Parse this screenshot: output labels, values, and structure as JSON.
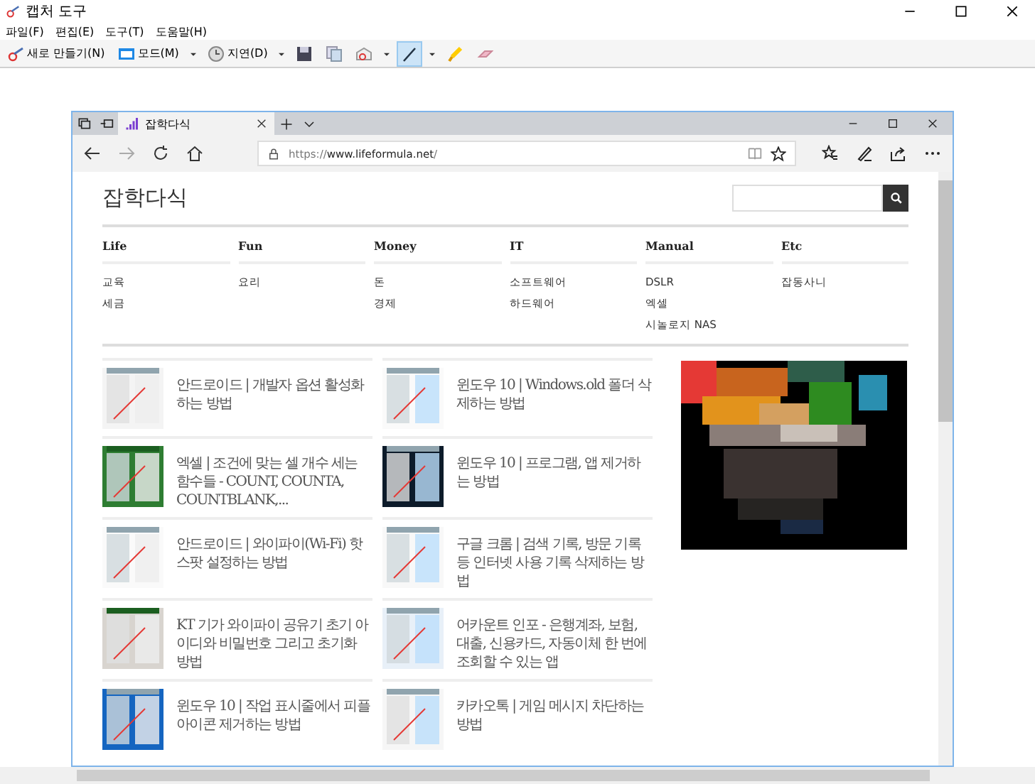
{
  "window": {
    "title": "캡처 도구"
  },
  "menu": [
    "파일(F)",
    "편집(E)",
    "도구(T)",
    "도움말(H)"
  ],
  "toolbar": [
    {
      "kind": "new",
      "label": "새로 만들기(N)",
      "selected": false
    },
    {
      "kind": "mode",
      "label": "모드(M)",
      "selected": false
    },
    {
      "kind": "delay",
      "label": "지연(D)",
      "selected": false
    },
    {
      "kind": "save",
      "selected": false
    },
    {
      "kind": "copy",
      "selected": false
    },
    {
      "kind": "send",
      "selected": false
    },
    {
      "kind": "pen",
      "selected": true
    },
    {
      "kind": "highlighter",
      "selected": false
    },
    {
      "kind": "eraser",
      "selected": false
    }
  ],
  "browser": {
    "tab": {
      "title": "잡학다식"
    },
    "url_prefix": "https://",
    "url_host": "www.lifeformula.net",
    "url_suffix": "/"
  },
  "site": {
    "logo": "잡학다식",
    "nav": [
      {
        "heading": "Life",
        "items": [
          "교육",
          "세금"
        ]
      },
      {
        "heading": "Fun",
        "items": [
          "요리"
        ]
      },
      {
        "heading": "Money",
        "items": [
          "돈",
          "경제"
        ]
      },
      {
        "heading": "IT",
        "items": [
          "소프트웨어",
          "하드웨어"
        ]
      },
      {
        "heading": "Manual",
        "items": [
          "DSLR",
          "엑셀",
          "시놀로지 NAS"
        ]
      },
      {
        "heading": "Etc",
        "items": [
          "잡동사니"
        ]
      }
    ],
    "articles": [
      {
        "kind": "picture",
        "title": "안드로이드 | 개발자 옵션 활성화하는 방법"
      },
      {
        "kind": "picture",
        "title": "윈도우 10 | Windows.old 폴더 삭제하는 방법"
      },
      {
        "kind": "picture",
        "title": "엑셀 | 조건에 맞는 셀 개수 세는 함수들 - COUNT, COUNTA, COUNTBLANK,..."
      },
      {
        "kind": "picture",
        "title": "윈도우 10 | 프로그램, 앱 제거하는 방법"
      },
      {
        "kind": "picture",
        "title": "안드로이드 | 와이파이(Wi-Fi) 핫스팟 설정하는 방법"
      },
      {
        "kind": "picture",
        "title": "구글 크롬 | 검색 기록, 방문 기록 등 인터넷 사용 기록 삭제하는 방법"
      },
      {
        "kind": "picture",
        "title": "KT 기가 와이파이 공유기 초기 아이디와 비밀번호 그리고 초기화 방법"
      },
      {
        "kind": "picture",
        "title": "어카운트 인포 - 은행계좌, 보험, 대출, 신용카드, 자동이체 한 번에 조회할 수 있는 앱"
      },
      {
        "kind": "picture",
        "title": "윈도우 10 | 작업 표시줄에서 피플 아이콘 제거하는 방법"
      },
      {
        "kind": "picture",
        "title": "카카오톡 | 게임 메시지 차단하는 방법"
      }
    ]
  }
}
